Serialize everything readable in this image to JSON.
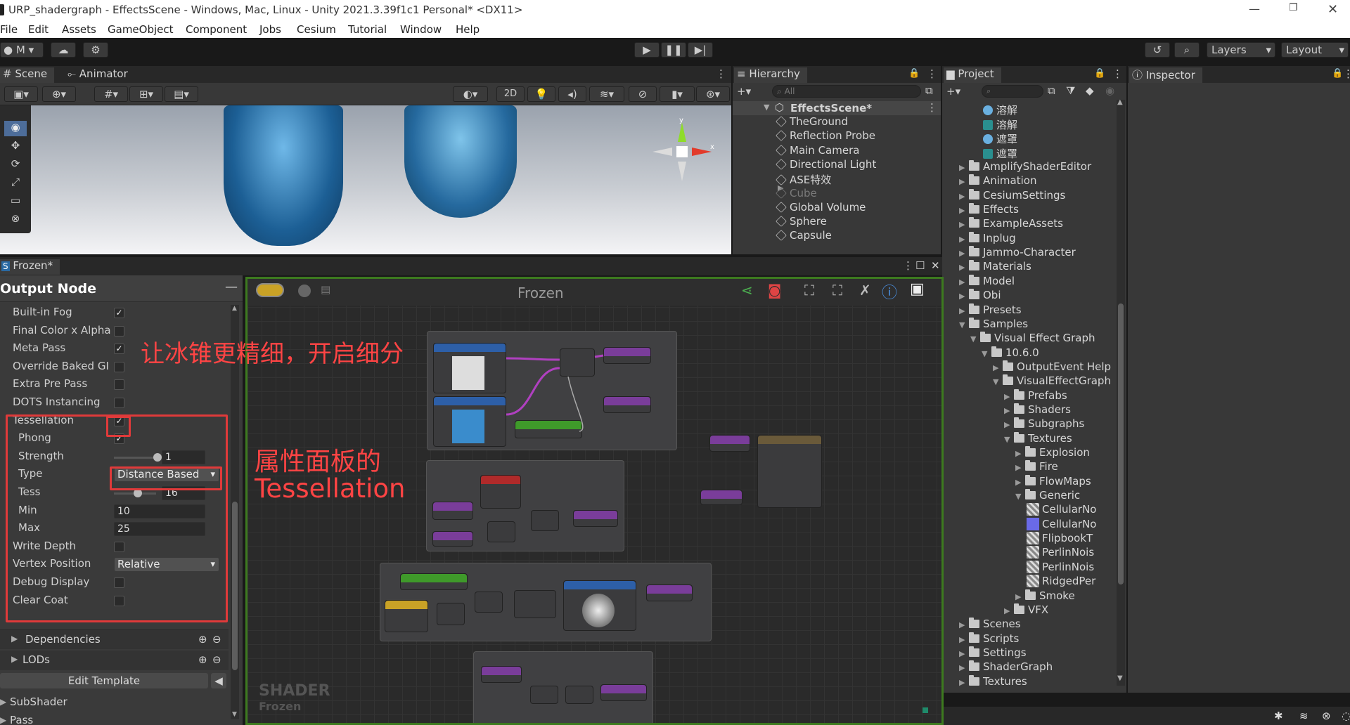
{
  "window": {
    "title": "URP_shadergraph - EffectsScene - Windows, Mac, Linux - Unity 2021.3.39f1c1 Personal* <DX11>"
  },
  "menu": [
    "File",
    "Edit",
    "Assets",
    "GameObject",
    "Component",
    "Jobs",
    "Cesium",
    "Tutorial",
    "Window",
    "Help"
  ],
  "toolbar": {
    "account": "M",
    "layers": "Layers",
    "layout": "Layout"
  },
  "scene": {
    "tab_scene": "Scene",
    "tab_animator": "Animator",
    "mode_2d": "2D",
    "gizmo_x": "x",
    "gizmo_y": "y"
  },
  "hierarchy": {
    "tab": "Hierarchy",
    "search_placeholder": "All",
    "scene_name": "EffectsScene*",
    "items": [
      {
        "label": "TheGround",
        "disabled": false
      },
      {
        "label": "Reflection Probe",
        "disabled": false
      },
      {
        "label": "Main Camera",
        "disabled": false
      },
      {
        "label": "Directional Light",
        "disabled": false
      },
      {
        "label": "ASE特效",
        "disabled": false
      },
      {
        "label": "Cube",
        "disabled": true
      },
      {
        "label": "Global Volume",
        "disabled": false
      },
      {
        "label": "Sphere",
        "disabled": false
      },
      {
        "label": "Capsule",
        "disabled": false
      }
    ]
  },
  "project": {
    "tab": "Project",
    "top_assets": [
      "溶解",
      "溶解",
      "遮罩",
      "遮罩"
    ],
    "tree": [
      {
        "label": "AmplifyShaderEditor",
        "indent": 0,
        "open": false
      },
      {
        "label": "Animation",
        "indent": 0,
        "open": false
      },
      {
        "label": "CesiumSettings",
        "indent": 0,
        "open": false
      },
      {
        "label": "Effects",
        "indent": 0,
        "open": false
      },
      {
        "label": "ExampleAssets",
        "indent": 0,
        "open": false
      },
      {
        "label": "Inplug",
        "indent": 0,
        "open": false
      },
      {
        "label": "Jammo-Character",
        "indent": 0,
        "open": false
      },
      {
        "label": "Materials",
        "indent": 0,
        "open": false
      },
      {
        "label": "Model",
        "indent": 0,
        "open": false
      },
      {
        "label": "Obi",
        "indent": 0,
        "open": false
      },
      {
        "label": "Presets",
        "indent": 0,
        "open": false
      },
      {
        "label": "Samples",
        "indent": 0,
        "open": true
      },
      {
        "label": "Visual Effect Graph",
        "indent": 1,
        "open": true
      },
      {
        "label": "10.6.0",
        "indent": 2,
        "open": true
      },
      {
        "label": "OutputEvent Help",
        "indent": 3,
        "open": false
      },
      {
        "label": "VisualEffectGraph",
        "indent": 3,
        "open": true
      },
      {
        "label": "Prefabs",
        "indent": 4,
        "open": false
      },
      {
        "label": "Shaders",
        "indent": 4,
        "open": false
      },
      {
        "label": "Subgraphs",
        "indent": 4,
        "open": false
      },
      {
        "label": "Textures",
        "indent": 4,
        "open": true
      },
      {
        "label": "Explosion",
        "indent": 5,
        "open": false
      },
      {
        "label": "Fire",
        "indent": 5,
        "open": false
      },
      {
        "label": "FlowMaps",
        "indent": 5,
        "open": false
      },
      {
        "label": "Generic",
        "indent": 5,
        "open": true
      },
      {
        "label": "CellularNo",
        "indent": 6,
        "asset": true
      },
      {
        "label": "CellularNo",
        "indent": 6,
        "asset": true
      },
      {
        "label": "FlipbookT",
        "indent": 6,
        "asset": true
      },
      {
        "label": "PerlinNois",
        "indent": 6,
        "asset": true
      },
      {
        "label": "PerlinNois",
        "indent": 6,
        "asset": true
      },
      {
        "label": "RidgedPer",
        "indent": 6,
        "asset": true
      },
      {
        "label": "Smoke",
        "indent": 5,
        "open": false
      },
      {
        "label": "VFX",
        "indent": 4,
        "open": false
      },
      {
        "label": "Scenes",
        "indent": 0,
        "open": false
      },
      {
        "label": "Scripts",
        "indent": 0,
        "open": false
      },
      {
        "label": "Settings",
        "indent": 0,
        "open": false
      },
      {
        "label": "ShaderGraph",
        "indent": 0,
        "open": false
      },
      {
        "label": "Textures",
        "indent": 0,
        "open": false
      }
    ]
  },
  "inspector": {
    "tab": "Inspector"
  },
  "ase": {
    "tab": "Frozen*",
    "panel_title": "Output Node",
    "graph_title": "Frozen",
    "watermark_1": "SHADER",
    "watermark_2": "Frozen",
    "props": [
      {
        "label": "Built-in Fog",
        "type": "check",
        "checked": true
      },
      {
        "label": "Final Color x Alpha",
        "type": "check",
        "checked": false
      },
      {
        "label": "Meta Pass",
        "type": "check",
        "checked": true
      },
      {
        "label": "Override Baked GI",
        "type": "check",
        "checked": false
      },
      {
        "label": "Extra Pre Pass",
        "type": "check",
        "checked": false
      },
      {
        "label": "DOTS Instancing",
        "type": "check",
        "checked": false
      },
      {
        "label": "Tessellation",
        "type": "check",
        "checked": true
      },
      {
        "label": "Phong",
        "type": "check",
        "checked": true,
        "indent": true
      },
      {
        "label": "Strength",
        "type": "slider",
        "value": "1",
        "fill": 1.0,
        "indent": true
      },
      {
        "label": "Type",
        "type": "drop",
        "value": "Distance Based",
        "indent": true
      },
      {
        "label": "Tess",
        "type": "slider",
        "value": "16",
        "fill": 0.5,
        "indent": true
      },
      {
        "label": "Min",
        "type": "field",
        "value": "10",
        "indent": true
      },
      {
        "label": "Max",
        "type": "field",
        "value": "25",
        "indent": true
      },
      {
        "label": "Write Depth",
        "type": "check",
        "checked": false
      },
      {
        "label": "Vertex Position",
        "type": "drop",
        "value": "Relative"
      },
      {
        "label": "Debug Display",
        "type": "check",
        "checked": false
      },
      {
        "label": "Clear Coat",
        "type": "check",
        "checked": false
      }
    ],
    "dependencies": "Dependencies",
    "lods": "LODs",
    "edit_template": "Edit Template",
    "subshader": "SubShader",
    "pass": "Pass"
  },
  "annotations": {
    "note1": "让冰锥更精细，开启细分",
    "note2a": "属性面板的",
    "note2b": "Tessellation"
  },
  "colors": {
    "accent_red": "#e03a3a",
    "graph_border": "#3d7a1f",
    "node_purple": "#7a3d9a",
    "node_blue": "#2d5fa8",
    "node_green": "#3f9a2a",
    "node_yellow": "#c9a226",
    "node_red": "#b02a2a"
  }
}
